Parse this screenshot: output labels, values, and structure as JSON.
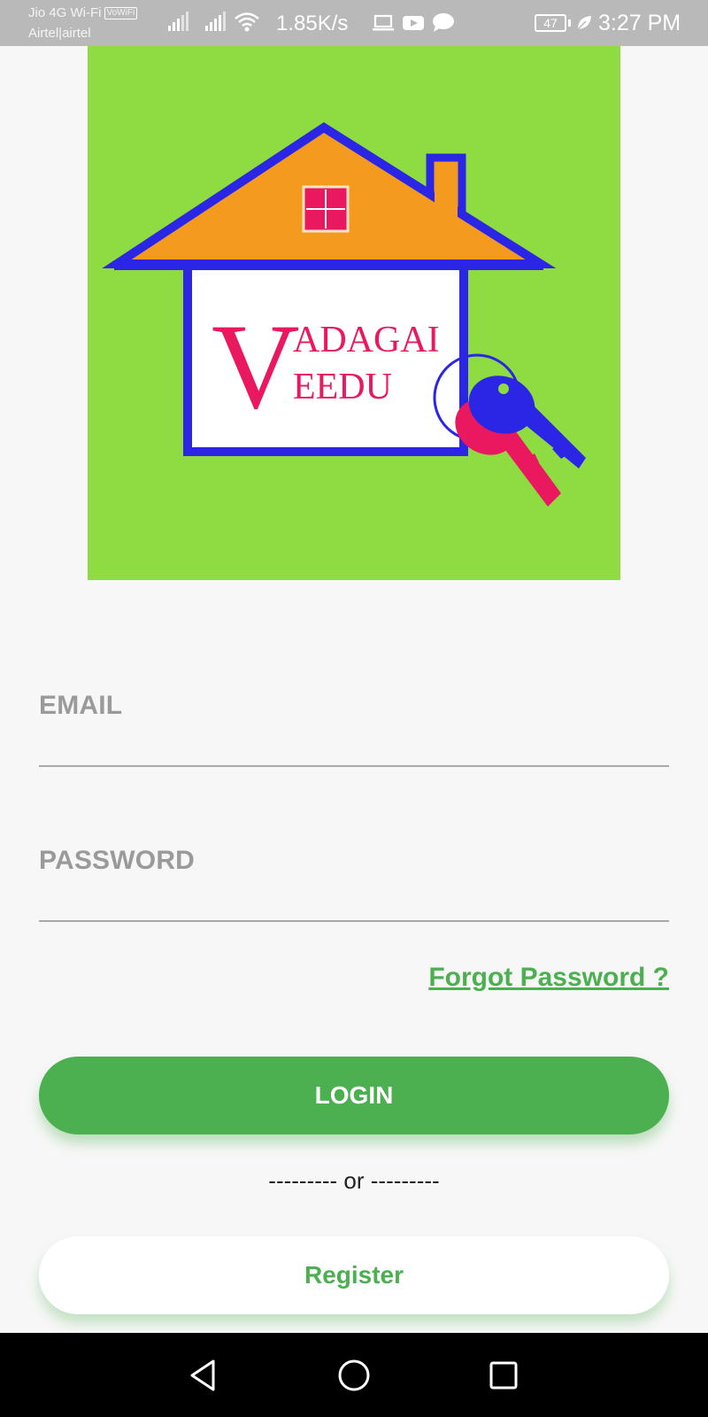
{
  "status_bar": {
    "carrier_1": "Jio 4G Wi-Fi",
    "vowifi_badge": "VoWiFi",
    "carrier_2": "Airtel|airtel",
    "network_speed": "1.85K/s",
    "battery_level": "47",
    "time": "3:27 PM",
    "icons": [
      "signal-icon",
      "signal-icon",
      "wifi-icon",
      "laptop-icon",
      "youtube-icon",
      "chat-icon",
      "battery-icon",
      "leaf-icon"
    ]
  },
  "logo": {
    "letter_v": "V",
    "text_adagai": "ADAGAI",
    "text_eedu": "EEDU",
    "colors": {
      "background": "#8edb42",
      "roof": "#f49a1e",
      "outline": "#2b25e6",
      "accent": "#e9185f"
    }
  },
  "form": {
    "email_label": "EMAIL",
    "password_label": "PASSWORD",
    "forgot_password": "Forgot Password ?",
    "login_button": "LOGIN",
    "or_divider": "--------- or ---------",
    "register_button": "Register"
  },
  "colors": {
    "accent_green": "#4caf50",
    "label_gray": "#9a9a9a"
  },
  "nav_bar": {
    "icons": [
      "back-icon",
      "home-icon",
      "recents-icon"
    ]
  }
}
